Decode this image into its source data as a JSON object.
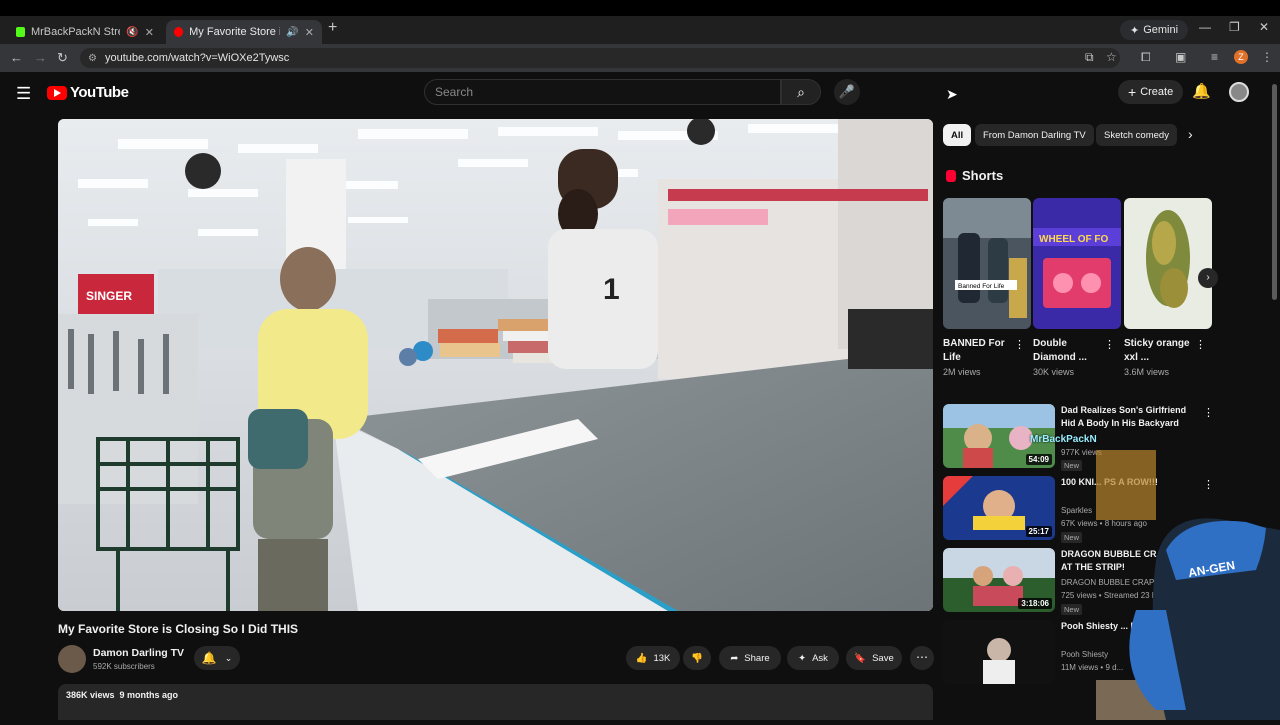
{
  "browser": {
    "tabs": [
      {
        "title": "MrBackPackN Stream - Watch",
        "favicon_color": "#53fc18"
      },
      {
        "title": "My Favorite Store is Closing",
        "favicon_color": "#ff0000"
      }
    ],
    "gemini_label": "Gemini",
    "url": "youtube.com/watch?v=WiOXe2Tywsc",
    "profile_initial": "Z"
  },
  "header": {
    "logo_text": "YouTube",
    "search_placeholder": "Search",
    "create_label": "Create"
  },
  "video": {
    "title": "My Favorite Store is Closing So I Did THIS",
    "channel": "Damon Darling TV",
    "subscribers": "592K subscribers",
    "likes": "13K",
    "share_label": "Share",
    "ask_label": "Ask",
    "save_label": "Save",
    "views_date": "386K views  9 months ago",
    "scene_sign": "SINGER"
  },
  "sidebar": {
    "chips": [
      "All",
      "From Damon Darling TV",
      "Sketch comedy"
    ],
    "shorts_heading": "Shorts",
    "shorts": [
      {
        "title": "BANNED For Life",
        "views": "2M views",
        "overlay": "Banned For Life"
      },
      {
        "title": "Double Diamond ...",
        "views": "30K views",
        "overlay": "WHEEL OF FO"
      },
      {
        "title": "Sticky orange xxl ...",
        "views": "3.6M views",
        "overlay": ""
      }
    ],
    "recommended": [
      {
        "title": "Dad Realizes Son's Girlfriend Hid A Body In His Backyard",
        "channel": "",
        "meta": "977K views",
        "duration": "54:09",
        "badge": "New"
      },
      {
        "title": "100 KNI... PS A ROW!!!",
        "channel": "Sparkles",
        "meta": "67K views • 8 hours ago",
        "duration": "25:17",
        "badge": "New"
      },
      {
        "title": "DRAGON BUBBLE CRAPS L... AT THE STRIP!",
        "channel": "DRAGON BUBBLE CRAPS",
        "meta": "725 views • Streamed 23 ho...",
        "duration": "3:18:06",
        "badge": "New"
      },
      {
        "title": "Pooh Shiesty ... Music Video]",
        "channel": "Pooh Shiesty",
        "meta": "11M views • 9 d...",
        "duration": "",
        "badge": ""
      }
    ]
  },
  "overlay": {
    "tag": "MrBackPackN",
    "chair_brand": "AN-GEN"
  },
  "colors": {
    "background": "#0f0f0f",
    "youtube_red": "#ff0000",
    "chip_bg": "#272727"
  }
}
